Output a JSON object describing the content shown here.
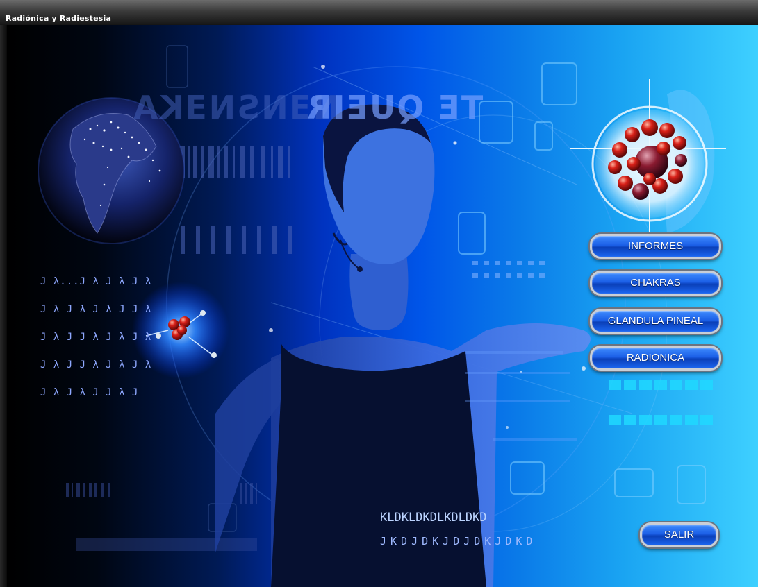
{
  "window": {
    "title": "Radiónica y Radiestesia"
  },
  "menu": {
    "informes_label": "INFORMES",
    "chakras_label": "CHAKRAS",
    "glandula_label": "GLANDULA PINEAL",
    "radionica_label": "RADIONICA",
    "salir_label": "SALIR"
  },
  "decor": {
    "mirror_text_left": "NƎNSNƎKA",
    "mirror_text_center": "TE QUEIR",
    "code_lines": [
      "KLDKLDKDLKDLDKD",
      "JKDJDKJDJDKJDKD"
    ],
    "lambda_rows": [
      "J λ...J λ J λ J λ",
      "J λ J λ J λ J J λ",
      "J λ J J λ J λ J λ",
      "J λ J J λ J λ J λ",
      "J λ J λ J J λ J"
    ]
  },
  "colors": {
    "button_blue": "#1b5fe6",
    "button_border": "#c9ced6",
    "accent_cyan": "#20d8ff",
    "molecule_red": "#e02020"
  },
  "icons": {
    "earth": "earth-globe-icon",
    "molecule_small": "atom-molecule-icon",
    "molecule_large": "crosshair-molecule-icon"
  }
}
